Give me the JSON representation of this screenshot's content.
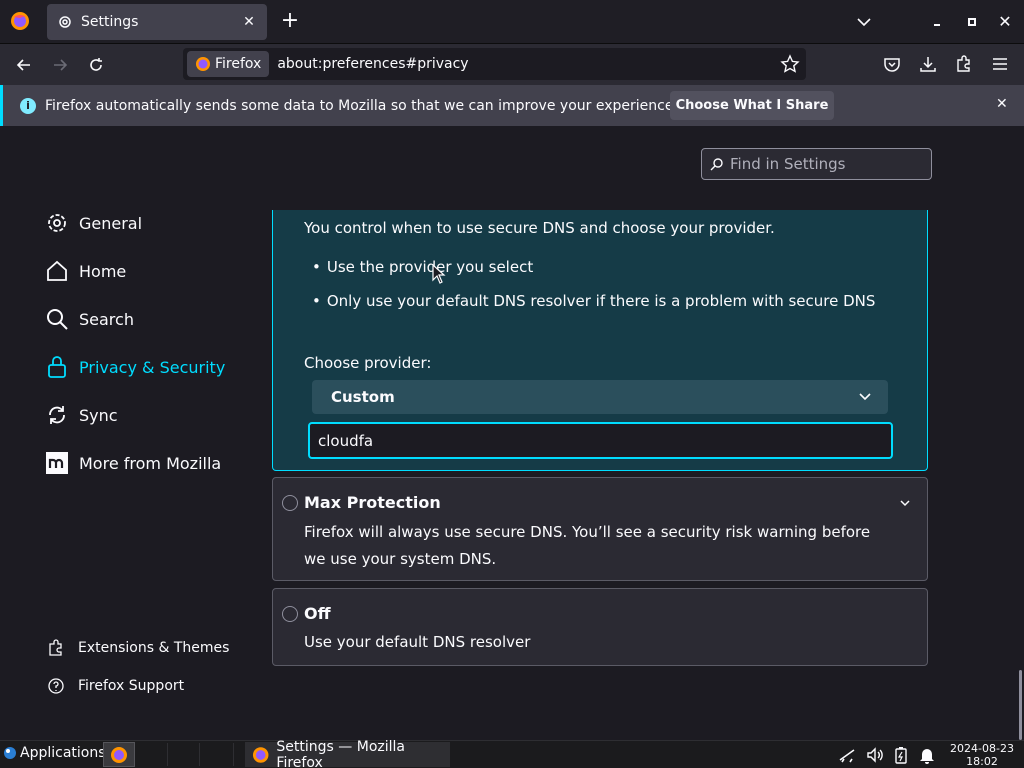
{
  "tab": {
    "title": "Settings",
    "close": "✕",
    "new_tab": "+"
  },
  "window_controls": {
    "close": "✕"
  },
  "urlbar": {
    "identity_label": "Firefox",
    "url": "about:preferences#privacy"
  },
  "notification": {
    "info_glyph": "i",
    "text": "Firefox automatically sends some data to Mozilla so that we can improve your experience.",
    "button": "Choose What I Share",
    "close": "✕"
  },
  "find": {
    "placeholder": "Find in Settings"
  },
  "sidebar": {
    "categories": [
      {
        "label": "General",
        "icon": "gear-icon"
      },
      {
        "label": "Home",
        "icon": "home-icon"
      },
      {
        "label": "Search",
        "icon": "search-icon"
      },
      {
        "label": "Privacy & Security",
        "icon": "lock-icon",
        "selected": true
      },
      {
        "label": "Sync",
        "icon": "sync-icon"
      },
      {
        "label": "More from Mozilla",
        "icon": "mozilla-icon"
      }
    ],
    "footer": [
      {
        "label": "Extensions & Themes",
        "icon": "puzzle-icon"
      },
      {
        "label": "Firefox Support",
        "icon": "help-icon"
      }
    ]
  },
  "dns": {
    "increased": {
      "description": "You control when to use secure DNS and choose your provider.",
      "bullets": [
        "Use the provider you select",
        "Only use your default DNS resolver if there is a problem with secure DNS"
      ],
      "choose_label": "Choose provider:",
      "provider_selected": "Custom",
      "custom_value": "cloudfa"
    },
    "max": {
      "title": "Max Protection",
      "description": "Firefox will always use secure DNS. You’ll see a security risk warning before we use your system DNS."
    },
    "off": {
      "title": "Off",
      "description": "Use your default DNS resolver"
    }
  },
  "taskbar": {
    "applications_label": "Applications",
    "window_title": "Settings — Mozilla Firefox",
    "date": "2024-08-23",
    "time": "18:02"
  },
  "colors": {
    "accent": "#00ddff",
    "background": "#1c1b22",
    "selected_panel": "#153b47"
  }
}
